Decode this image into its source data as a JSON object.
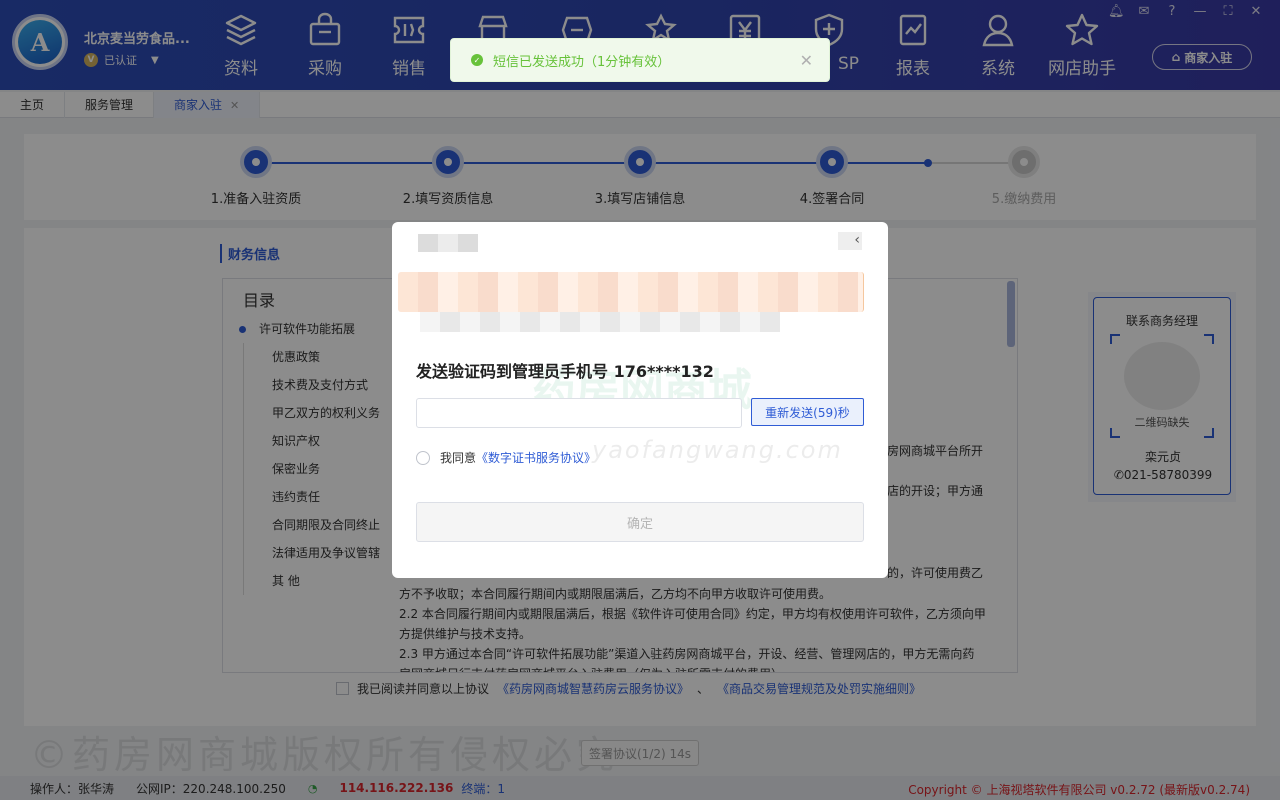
{
  "header": {
    "company": "北京麦当劳食品...",
    "cert_label": "已认证",
    "nav": [
      {
        "label": "资料",
        "icon": "layers-icon"
      },
      {
        "label": "采购",
        "icon": "bag-icon"
      },
      {
        "label": "销售",
        "icon": "ticket-icon"
      },
      {
        "label": "",
        "icon": "store-icon"
      },
      {
        "label": "",
        "icon": "coupon-icon"
      },
      {
        "label": "",
        "icon": "badge-icon"
      },
      {
        "label": "",
        "icon": "yen-icon"
      },
      {
        "label": "SP",
        "icon": "shield-icon"
      },
      {
        "label": "报表",
        "icon": "chart-icon"
      },
      {
        "label": "系统",
        "icon": "user-icon"
      },
      {
        "label": "网店助手",
        "icon": "star-icon"
      }
    ],
    "merchant_button": "商家入驻"
  },
  "toast": {
    "message": "短信已发送成功（1分钟有效）"
  },
  "tabs": [
    {
      "label": "主页"
    },
    {
      "label": "服务管理"
    },
    {
      "label": "商家入驻"
    }
  ],
  "steps": [
    {
      "label": "1.准备入驻资质",
      "done": true
    },
    {
      "label": "2.填写资质信息",
      "done": true
    },
    {
      "label": "3.填写店铺信息",
      "done": true
    },
    {
      "label": "4.签署合同",
      "done": true
    },
    {
      "label": "5.缴纳费用",
      "done": false
    }
  ],
  "section_title": "财务信息",
  "toc": {
    "title": "目录",
    "items": [
      "许可软件功能拓展",
      "优惠政策",
      "技术费及支付方式",
      "甲乙双方的权利义务",
      "知识产权",
      "保密业务",
      "违约责任",
      "合同期限及合同终止",
      "法律适用及争议管辖",
      "其 他"
    ]
  },
  "contract_text": {
    "frag1": "房网商城平台所开",
    "frag2": "店的开设；甲方通",
    "frag3": "的，许可使用费乙",
    "line1": "方不予收取；本合同履行期间内或期限届满后，乙方均不向甲方收取许可使用费。",
    "line2": "2.2 本合同履行期间内或期限届满后，根据《软件许可使用合同》约定，甲方均有权使用许可软件，乙方须向甲",
    "line3": "方提供维护与技术支持。",
    "line4": "2.3 甲方通过本合同“许可软件拓展功能”渠道入驻药房网商城平台，开设、经营、管理网店的，甲方无需向药",
    "line5": "房网商城另行支付药房网商城平台入驻费用（仅为入驻所需支付的费用）"
  },
  "agreement": {
    "prefix": "我已阅读并同意以上协议",
    "link1": "《药房网商城智慧药房云服务协议》",
    "sep": "、",
    "link2": "《商品交易管理规范及处罚实施细则》"
  },
  "sign_button": "签署协议(1/2) 14s",
  "watermark": "©药房网商城版权所有侵权必究",
  "manager": {
    "title": "联系商务经理",
    "qr_missing": "二维码缺失",
    "name": "栾元贞",
    "phone": "021-58780399"
  },
  "modal": {
    "send_text": "发送验证码到管理员手机号 176****132",
    "code_value": "",
    "resend_label": "重新发送(59)秒",
    "agree_prefix": "我同意",
    "agree_link": "《数字证书服务协议》",
    "watermark_cn": "药房网商城",
    "watermark_en": "yaofangwang.com",
    "confirm_label": "确定"
  },
  "status_bar": {
    "operator": "操作人：张华涛",
    "public_ip": "公网IP：220.248.100.250",
    "server_ip": "114.116.222.136",
    "terminal": "终端：1",
    "copyright": "Copyright © 上海视塔软件有限公司 v0.2.72 (最新版v0.2.74)"
  },
  "colors": {
    "primary": "#2f5cd5",
    "header": "#2f46b0",
    "success": "#67c23a",
    "danger": "#d9262c"
  }
}
